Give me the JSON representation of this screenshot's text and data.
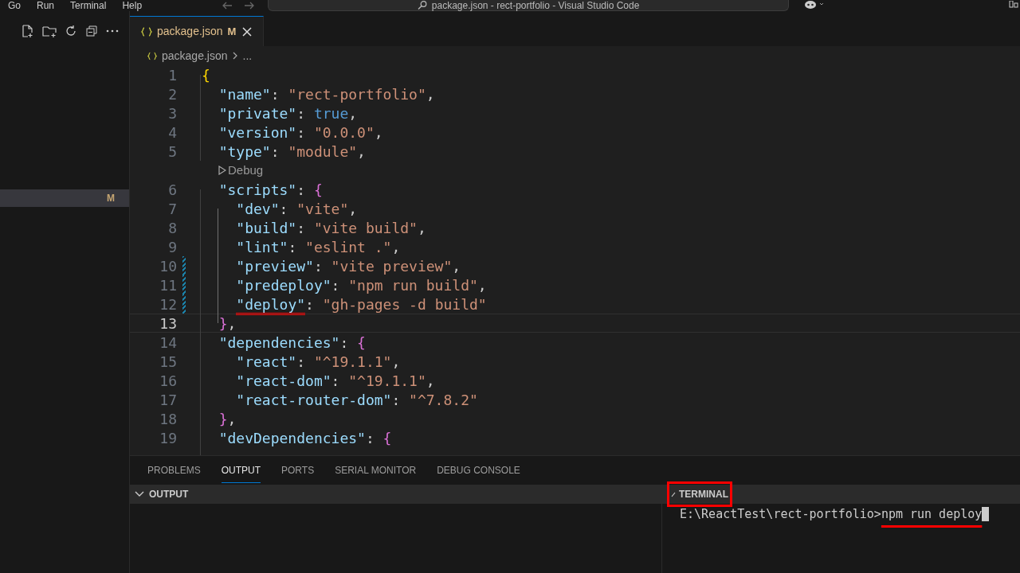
{
  "menu": [
    "Go",
    "Run",
    "Terminal",
    "Help"
  ],
  "title": "package.json - rect-portfolio - Visual Studio Code",
  "explorer": {
    "badge": "M"
  },
  "tabs": [
    {
      "label": "package.json",
      "badge": "M",
      "selected": true
    }
  ],
  "breadcrumb": {
    "file": "package.json",
    "rest": "..."
  },
  "lines": [
    {
      "kind": "code",
      "n": "1",
      "current": false,
      "modified": false,
      "tokens": [
        {
          "t": "{",
          "kind": "brace1"
        }
      ]
    },
    {
      "kind": "code",
      "n": "2",
      "current": false,
      "modified": false,
      "tokens": [
        {
          "t": "  \"name\"",
          "kind": "key"
        },
        {
          "t": ": ",
          "kind": "punct"
        },
        {
          "t": "\"rect-portfolio\"",
          "kind": "str"
        },
        {
          "t": ",",
          "kind": "punct"
        }
      ]
    },
    {
      "kind": "code",
      "n": "3",
      "current": false,
      "modified": false,
      "tokens": [
        {
          "t": "  \"private\"",
          "kind": "key"
        },
        {
          "t": ": ",
          "kind": "punct"
        },
        {
          "t": "true",
          "kind": "bool"
        },
        {
          "t": ",",
          "kind": "punct"
        }
      ]
    },
    {
      "kind": "code",
      "n": "4",
      "current": false,
      "modified": false,
      "tokens": [
        {
          "t": "  \"version\"",
          "kind": "key"
        },
        {
          "t": ": ",
          "kind": "punct"
        },
        {
          "t": "\"0.0.0\"",
          "kind": "str"
        },
        {
          "t": ",",
          "kind": "punct"
        }
      ]
    },
    {
      "kind": "code",
      "n": "5",
      "current": false,
      "modified": false,
      "tokens": [
        {
          "t": "  \"type\"",
          "kind": "key"
        },
        {
          "t": ": ",
          "kind": "punct"
        },
        {
          "t": "\"module\"",
          "kind": "str"
        },
        {
          "t": ",",
          "kind": "punct"
        }
      ]
    },
    {
      "kind": "codelens",
      "label": "Debug"
    },
    {
      "kind": "code",
      "n": "6",
      "current": false,
      "modified": false,
      "tokens": [
        {
          "t": "  \"scripts\"",
          "kind": "key"
        },
        {
          "t": ": ",
          "kind": "punct"
        },
        {
          "t": "{",
          "kind": "brace2"
        }
      ]
    },
    {
      "kind": "code",
      "n": "7",
      "current": false,
      "modified": false,
      "tokens": [
        {
          "t": "    \"dev\"",
          "kind": "key"
        },
        {
          "t": ": ",
          "kind": "punct"
        },
        {
          "t": "\"vite\"",
          "kind": "str"
        },
        {
          "t": ",",
          "kind": "punct"
        }
      ]
    },
    {
      "kind": "code",
      "n": "8",
      "current": false,
      "modified": false,
      "tokens": [
        {
          "t": "    \"build\"",
          "kind": "key"
        },
        {
          "t": ": ",
          "kind": "punct"
        },
        {
          "t": "\"vite build\"",
          "kind": "str"
        },
        {
          "t": ",",
          "kind": "punct"
        }
      ]
    },
    {
      "kind": "code",
      "n": "9",
      "current": false,
      "modified": false,
      "tokens": [
        {
          "t": "    \"lint\"",
          "kind": "key"
        },
        {
          "t": ": ",
          "kind": "punct"
        },
        {
          "t": "\"eslint .\"",
          "kind": "str"
        },
        {
          "t": ",",
          "kind": "punct"
        }
      ]
    },
    {
      "kind": "code",
      "n": "10",
      "current": false,
      "modified": true,
      "tokens": [
        {
          "t": "    \"preview\"",
          "kind": "key"
        },
        {
          "t": ": ",
          "kind": "punct"
        },
        {
          "t": "\"vite preview\"",
          "kind": "str"
        },
        {
          "t": ",",
          "kind": "punct"
        }
      ]
    },
    {
      "kind": "code",
      "n": "11",
      "current": false,
      "modified": true,
      "tokens": [
        {
          "t": "    \"predeploy\"",
          "kind": "key"
        },
        {
          "t": ": ",
          "kind": "punct"
        },
        {
          "t": "\"npm run build\"",
          "kind": "str"
        },
        {
          "t": ",",
          "kind": "punct"
        }
      ]
    },
    {
      "kind": "code",
      "n": "12",
      "current": false,
      "modified": true,
      "tokens": [
        {
          "t": "    \"deploy\"",
          "kind": "key",
          "annotated": true
        },
        {
          "t": ": ",
          "kind": "punct"
        },
        {
          "t": "\"gh-pages -d build\"",
          "kind": "str"
        }
      ]
    },
    {
      "kind": "code",
      "n": "13",
      "current": true,
      "modified": false,
      "tokens": [
        {
          "t": "  }",
          "kind": "brace2"
        },
        {
          "t": ",",
          "kind": "punct"
        }
      ]
    },
    {
      "kind": "code",
      "n": "14",
      "current": false,
      "modified": false,
      "tokens": [
        {
          "t": "  \"dependencies\"",
          "kind": "key"
        },
        {
          "t": ": ",
          "kind": "punct"
        },
        {
          "t": "{",
          "kind": "brace2"
        }
      ]
    },
    {
      "kind": "code",
      "n": "15",
      "current": false,
      "modified": false,
      "tokens": [
        {
          "t": "    \"react\"",
          "kind": "key"
        },
        {
          "t": ": ",
          "kind": "punct"
        },
        {
          "t": "\"^19.1.1\"",
          "kind": "str"
        },
        {
          "t": ",",
          "kind": "punct"
        }
      ]
    },
    {
      "kind": "code",
      "n": "16",
      "current": false,
      "modified": false,
      "tokens": [
        {
          "t": "    \"react-dom\"",
          "kind": "key"
        },
        {
          "t": ": ",
          "kind": "punct"
        },
        {
          "t": "\"^19.1.1\"",
          "kind": "str"
        },
        {
          "t": ",",
          "kind": "punct"
        }
      ]
    },
    {
      "kind": "code",
      "n": "17",
      "current": false,
      "modified": false,
      "tokens": [
        {
          "t": "    \"react-router-dom\"",
          "kind": "key"
        },
        {
          "t": ": ",
          "kind": "punct"
        },
        {
          "t": "\"^7.8.2\"",
          "kind": "str"
        }
      ]
    },
    {
      "kind": "code",
      "n": "18",
      "current": false,
      "modified": false,
      "tokens": [
        {
          "t": "  }",
          "kind": "brace2"
        },
        {
          "t": ",",
          "kind": "punct"
        }
      ]
    },
    {
      "kind": "code",
      "n": "19",
      "current": false,
      "modified": false,
      "tokens": [
        {
          "t": "  \"devDependencies\"",
          "kind": "key"
        },
        {
          "t": ": ",
          "kind": "punct"
        },
        {
          "t": "{",
          "kind": "brace2"
        }
      ]
    }
  ],
  "panel_tabs": [
    {
      "label": "PROBLEMS",
      "selected": false
    },
    {
      "label": "OUTPUT",
      "selected": true
    },
    {
      "label": "PORTS",
      "selected": false
    },
    {
      "label": "SERIAL MONITOR",
      "selected": false
    },
    {
      "label": "DEBUG CONSOLE",
      "selected": false
    }
  ],
  "output": {
    "title": "OUTPUT"
  },
  "terminal": {
    "title": "TERMINAL",
    "prompt": "E:\\ReactTest\\rect-portfolio>",
    "command": "npm run deploy"
  }
}
